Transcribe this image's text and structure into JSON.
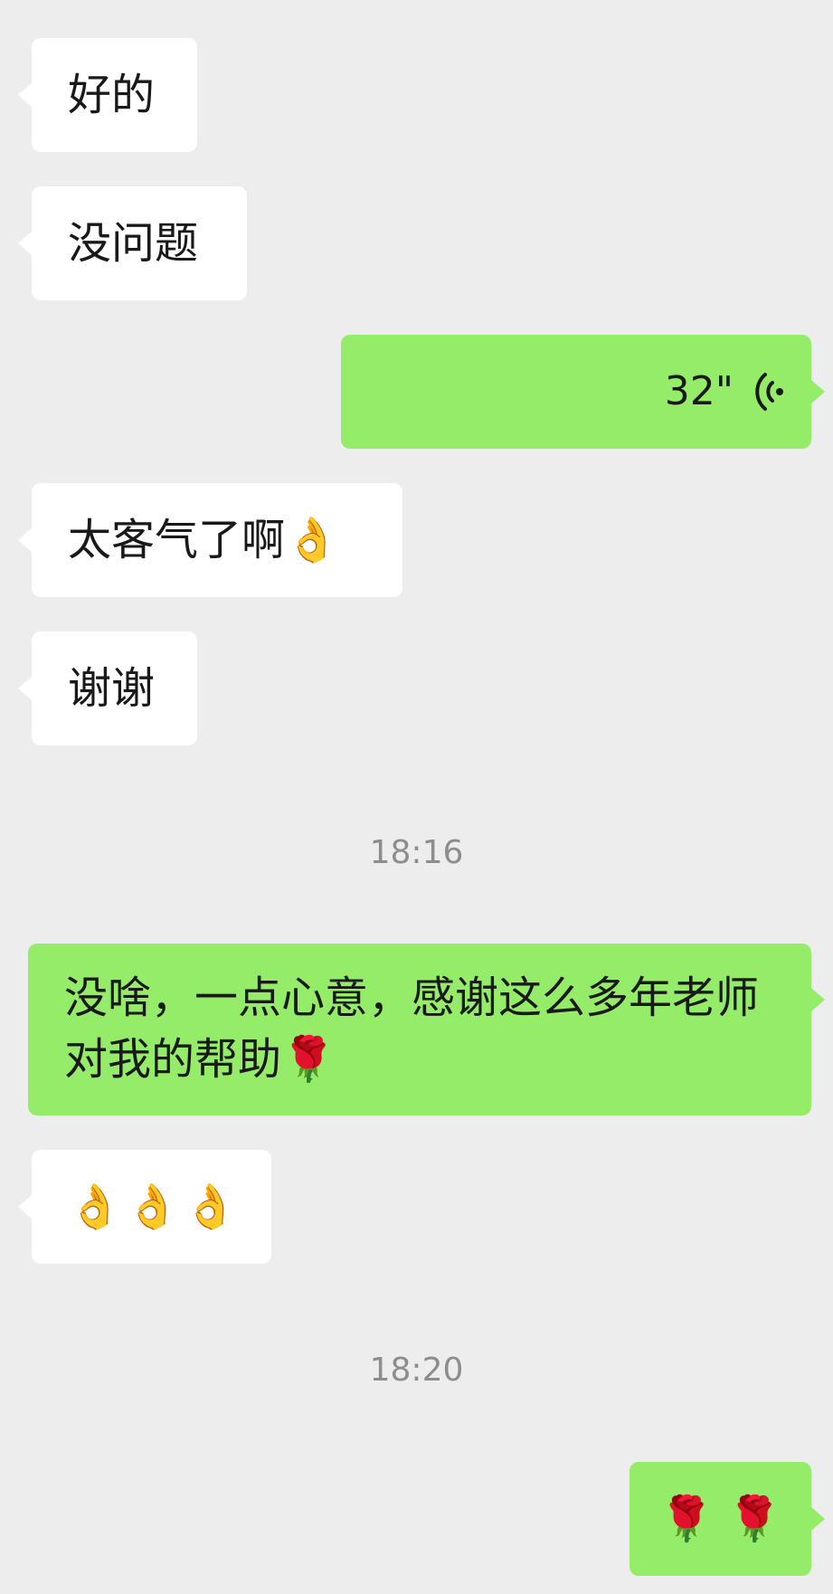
{
  "messages": [
    {
      "id": "m1",
      "side": "in",
      "text": "好的"
    },
    {
      "id": "m2",
      "side": "in",
      "text": "没问题"
    },
    {
      "id": "m3",
      "side": "out",
      "type": "voice",
      "duration": "32\"",
      "icon": "voice-wave-icon"
    },
    {
      "id": "m4",
      "side": "in",
      "text": "太客气了啊👌"
    },
    {
      "id": "m5",
      "side": "in",
      "text": "谢谢"
    },
    {
      "id": "m6",
      "side": "out",
      "text": "没啥，一点心意，感谢这么多年老师对我的帮助🌹"
    },
    {
      "id": "m7",
      "side": "in",
      "text": "👌👌👌"
    },
    {
      "id": "m8",
      "side": "out",
      "text": "🌹 🌹"
    }
  ],
  "timestamps": {
    "t1": "18:16",
    "t2": "18:20"
  },
  "colors": {
    "background": "#ededed",
    "incoming_bubble": "#ffffff",
    "outgoing_bubble": "#95ec69",
    "timestamp_text": "#8d8d8d"
  }
}
